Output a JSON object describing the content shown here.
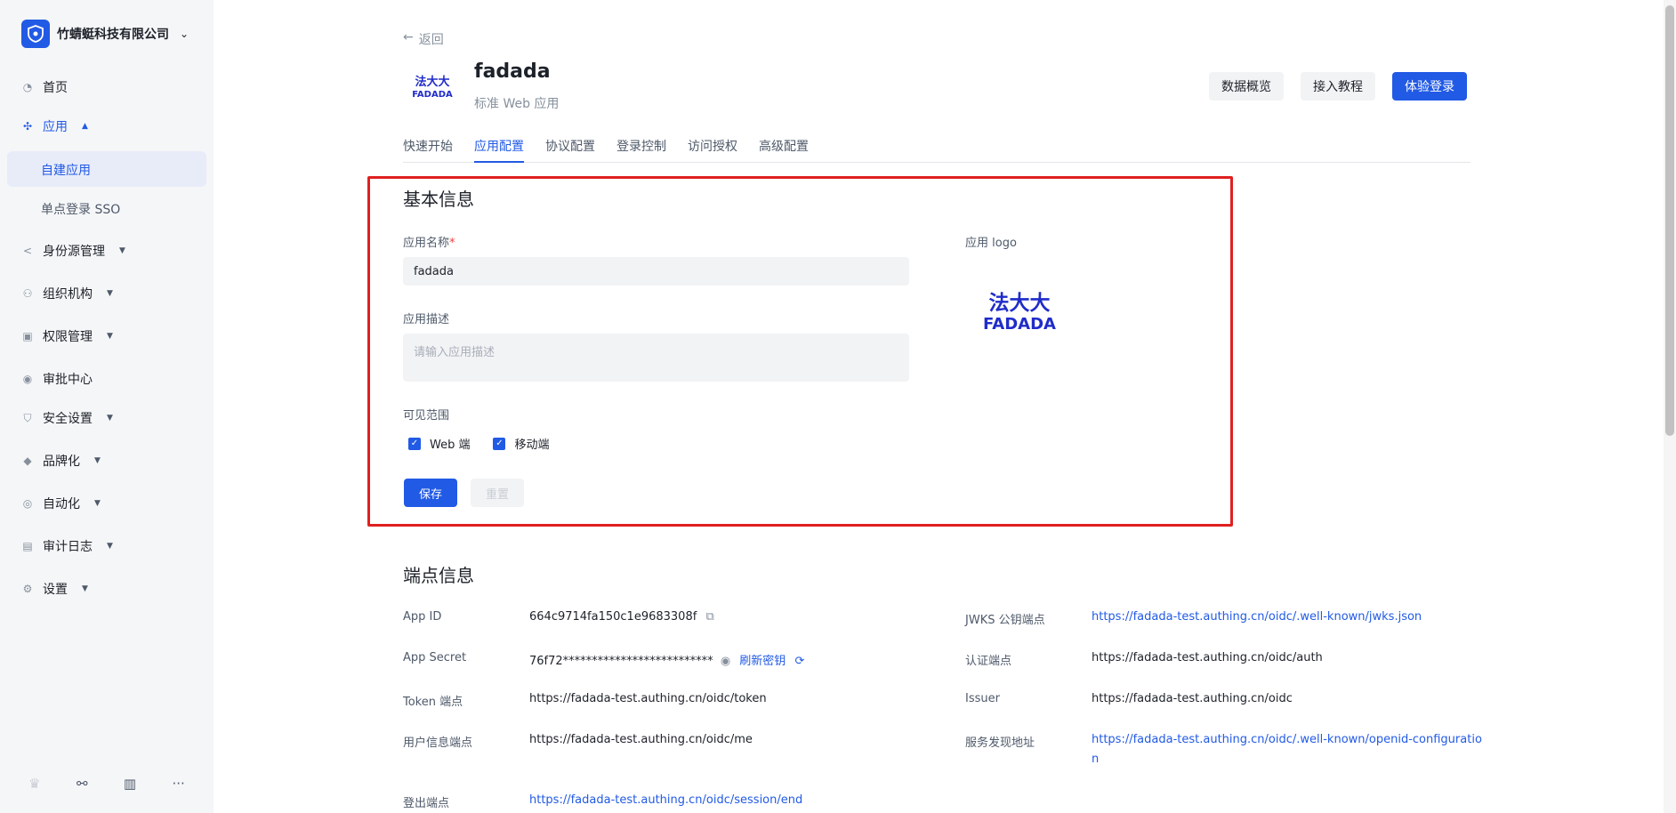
{
  "sidebar": {
    "org_name": "竹蜻蜓科技有限公司",
    "items": [
      {
        "label": "首页",
        "icon": "home-icon"
      },
      {
        "label": "应用",
        "icon": "apps-icon"
      },
      {
        "label": "身份源管理",
        "icon": "share-icon"
      },
      {
        "label": "组织机构",
        "icon": "org-icon"
      },
      {
        "label": "权限管理",
        "icon": "lock-icon"
      },
      {
        "label": "审批中心",
        "icon": "user-icon"
      },
      {
        "label": "安全设置",
        "icon": "shield-icon"
      },
      {
        "label": "品牌化",
        "icon": "brand-icon"
      },
      {
        "label": "自动化",
        "icon": "automation-icon"
      },
      {
        "label": "审计日志",
        "icon": "log-icon"
      },
      {
        "label": "设置",
        "icon": "gear-icon"
      }
    ],
    "sub_items": [
      {
        "label": "自建应用"
      },
      {
        "label": "单点登录 SSO"
      }
    ]
  },
  "header": {
    "back_label": "返回",
    "app_name": "fadada",
    "app_type": "标准 Web 应用",
    "buttons": {
      "overview": "数据概览",
      "tutorial": "接入教程",
      "try_login": "体验登录"
    }
  },
  "tabs": [
    {
      "label": "快速开始"
    },
    {
      "label": "应用配置"
    },
    {
      "label": "协议配置"
    },
    {
      "label": "登录控制"
    },
    {
      "label": "访问授权"
    },
    {
      "label": "高级配置"
    }
  ],
  "basic": {
    "title": "基本信息",
    "name_label": "应用名称",
    "name_required": "*",
    "name_value": "fadada",
    "desc_label": "应用描述",
    "desc_placeholder": "请输入应用描述",
    "visibility_label": "可见范围",
    "web_label": "Web 端",
    "mobile_label": "移动端",
    "logo_label": "应用 logo",
    "save": "保存",
    "reset": "重置"
  },
  "logo": {
    "cn": "法大大",
    "en": "FADADA",
    "color": "#1f2cc9"
  },
  "endpoints": {
    "title": "端点信息",
    "left": [
      {
        "key": "App ID",
        "value": "664c9714fa150c1e9683308f"
      },
      {
        "key": "App Secret",
        "value": "76f72**************************"
      },
      {
        "key": "Token 端点",
        "value": "https://fadada-test.authing.cn/oidc/token"
      },
      {
        "key": "用户信息端点",
        "value": "https://fadada-test.authing.cn/oidc/me"
      },
      {
        "key": "登出端点",
        "value": "https://fadada-test.authing.cn/oidc/session/end"
      }
    ],
    "refresh_label": "刷新密钥",
    "right": [
      {
        "key": "JWKS 公钥端点",
        "value": "https://fadada-test.authing.cn/oidc/.well-known/jwks.json"
      },
      {
        "key": "认证端点",
        "value": "https://fadada-test.authing.cn/oidc/auth"
      },
      {
        "key": "Issuer",
        "value": "https://fadada-test.authing.cn/oidc"
      },
      {
        "key": "服务发现地址",
        "value": "https://fadada-test.authing.cn/oidc/.well-known/openid-configuratio",
        "value2": "n"
      }
    ]
  },
  "colors": {
    "accent": "#215ae5",
    "highlight": "#e02020"
  }
}
